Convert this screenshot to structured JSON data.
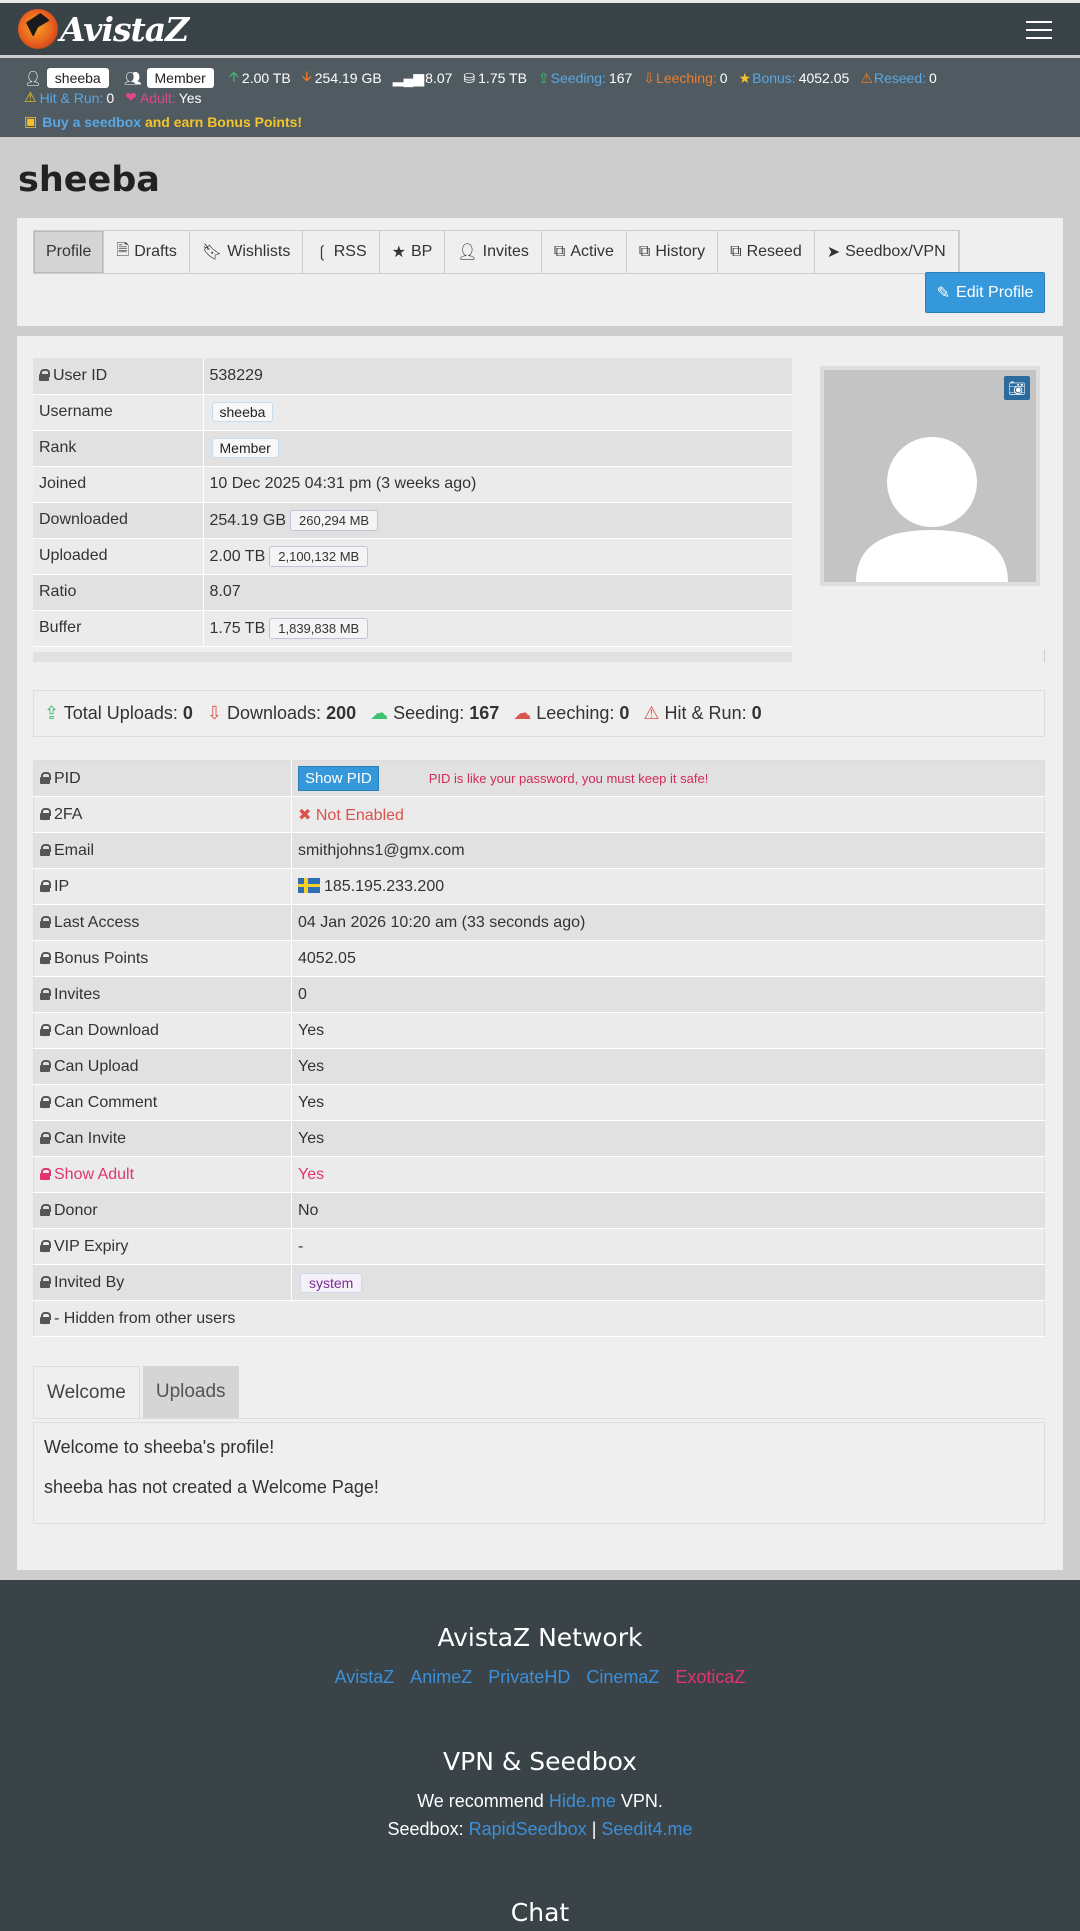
{
  "brand": {
    "name": "AvistaZ"
  },
  "statbar": {
    "username": "sheeba",
    "rank": "Member",
    "uploaded": "2.00 TB",
    "downloaded": "254.19 GB",
    "ratio": "8.07",
    "buffer": "1.75 TB",
    "seeding_label": "Seeding:",
    "seeding": "167",
    "leeching_label": "Leeching:",
    "leeching": "0",
    "bonus_label": "Bonus:",
    "bonus": "4052.05",
    "reseed_label": "Reseed:",
    "reseed": "0",
    "hitrun_label": "Hit & Run:",
    "hitrun": "0",
    "adult_label": "Adult:",
    "adult": "Yes",
    "promo_link": "Buy a seedbox",
    "promo_text": "and earn Bonus Points!"
  },
  "page_title": "sheeba",
  "tabs": [
    {
      "label": "Profile",
      "icon": "none"
    },
    {
      "label": "Drafts",
      "icon": "file-icon"
    },
    {
      "label": "Wishlists",
      "icon": "bookmark-icon"
    },
    {
      "label": "RSS",
      "icon": "rss-icon"
    },
    {
      "label": "BP",
      "icon": "star-icon"
    },
    {
      "label": "Invites",
      "icon": "user-icon"
    },
    {
      "label": "Active",
      "icon": "copy-icon"
    },
    {
      "label": "History",
      "icon": "copy-icon"
    },
    {
      "label": "Reseed",
      "icon": "copy-icon"
    },
    {
      "label": "Seedbox/VPN",
      "icon": "send-icon"
    }
  ],
  "edit_profile": "Edit Profile",
  "info": {
    "user_id_label": "User ID",
    "user_id": "538229",
    "username_label": "Username",
    "username": "sheeba",
    "rank_label": "Rank",
    "rank": "Member",
    "joined_label": "Joined",
    "joined": "10 Dec 2025 04:31 pm (3 weeks ago)",
    "downloaded_label": "Downloaded",
    "downloaded": "254.19 GB",
    "downloaded_mb": "260,294 MB",
    "uploaded_label": "Uploaded",
    "uploaded": "2.00 TB",
    "uploaded_mb": "2,100,132 MB",
    "ratio_label": "Ratio",
    "ratio": "8.07",
    "buffer_label": "Buffer",
    "buffer": "1.75 TB",
    "buffer_mb": "1,839,838 MB"
  },
  "summary": {
    "total_uploads_label": "Total Uploads:",
    "total_uploads": "0",
    "downloads_label": "Downloads:",
    "downloads": "200",
    "seeding_label": "Seeding:",
    "seeding": "167",
    "leeching_label": "Leeching:",
    "leeching": "0",
    "hitrun_label": "Hit & Run:",
    "hitrun": "0"
  },
  "details": {
    "pid_label": "PID",
    "pid_button": "Show PID",
    "pid_note": "PID is like your password, you must keep it safe!",
    "twofa_label": "2FA",
    "twofa": "Not Enabled",
    "email_label": "Email",
    "email": "smithjohns1@gmx.com",
    "ip_label": "IP",
    "ip": "185.195.233.200",
    "last_access_label": "Last Access",
    "last_access": "04 Jan 2026 10:20 am (33 seconds ago)",
    "bonus_label": "Bonus Points",
    "bonus": "4052.05",
    "invites_label": "Invites",
    "invites": "0",
    "can_download_label": "Can Download",
    "can_download": "Yes",
    "can_upload_label": "Can Upload",
    "can_upload": "Yes",
    "can_comment_label": "Can Comment",
    "can_comment": "Yes",
    "can_invite_label": "Can Invite",
    "can_invite": "Yes",
    "show_adult_label": "Show Adult",
    "show_adult": "Yes",
    "donor_label": "Donor",
    "donor": "No",
    "vip_label": "VIP Expiry",
    "vip": "-",
    "invited_by_label": "Invited By",
    "invited_by": "system",
    "hidden_note": "- Hidden from other users"
  },
  "welcome": {
    "tab_welcome": "Welcome",
    "tab_uploads": "Uploads",
    "line1": "Welcome to sheeba's profile!",
    "line2": "sheeba has not created a Welcome Page!"
  },
  "footer": {
    "network_title": "AvistaZ Network",
    "links": [
      "AvistaZ",
      "AnimeZ",
      "PrivateHD",
      "CinemaZ",
      "ExoticaZ"
    ],
    "vpn_title": "VPN & Seedbox",
    "vpn_pre": "We recommend",
    "vpn_link": "Hide.me",
    "vpn_post": "VPN.",
    "seedbox_pre": "Seedbox:",
    "seedbox_link1": "RapidSeedbox",
    "seedbox_sep": "|",
    "seedbox_link2": "Seedit4.me",
    "chat_title": "Chat"
  },
  "colors": {
    "accent": "#3498db",
    "topbar": "#3a4347",
    "statbar": "#4f5b61",
    "danger": "#d9534f",
    "adult": "#e0356f",
    "seeding": "#3fbf6f"
  }
}
